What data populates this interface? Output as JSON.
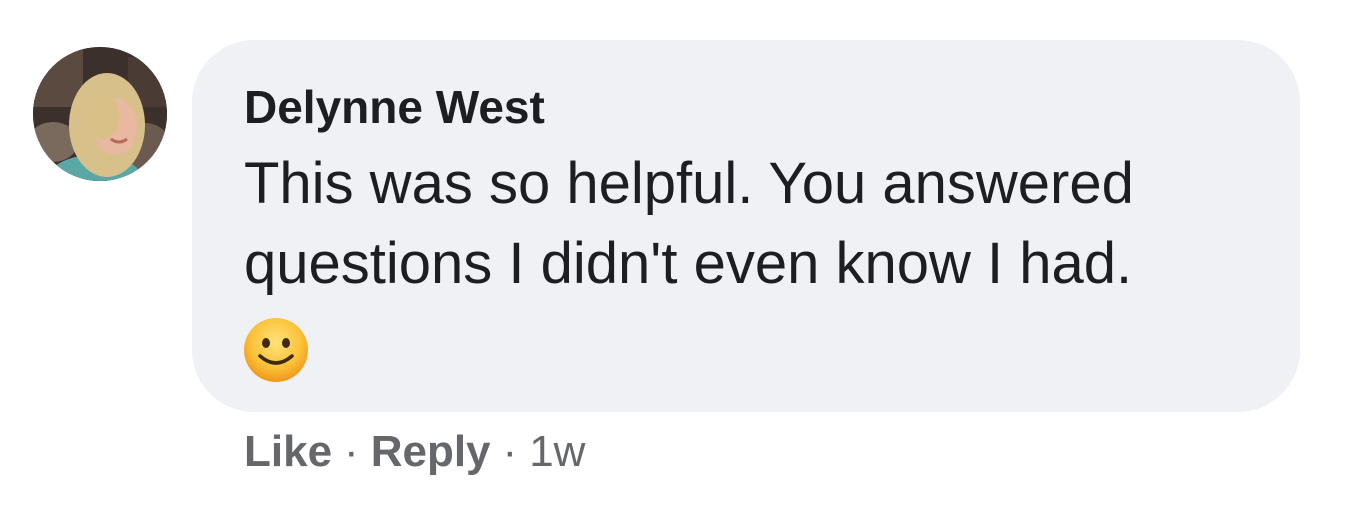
{
  "comment": {
    "author": "Delynne West",
    "text_lines": [
      "This was so helpful. You answered",
      "questions I didn't even know I had."
    ],
    "emoji": "slightly-smiling-face-icon",
    "actions": {
      "like_label": "Like",
      "separator": "·",
      "reply_label": "Reply",
      "timestamp": "1w"
    }
  },
  "colors": {
    "bubble_bg": "#f0f1f5",
    "text": "#1c1e21",
    "muted": "#65676b"
  }
}
